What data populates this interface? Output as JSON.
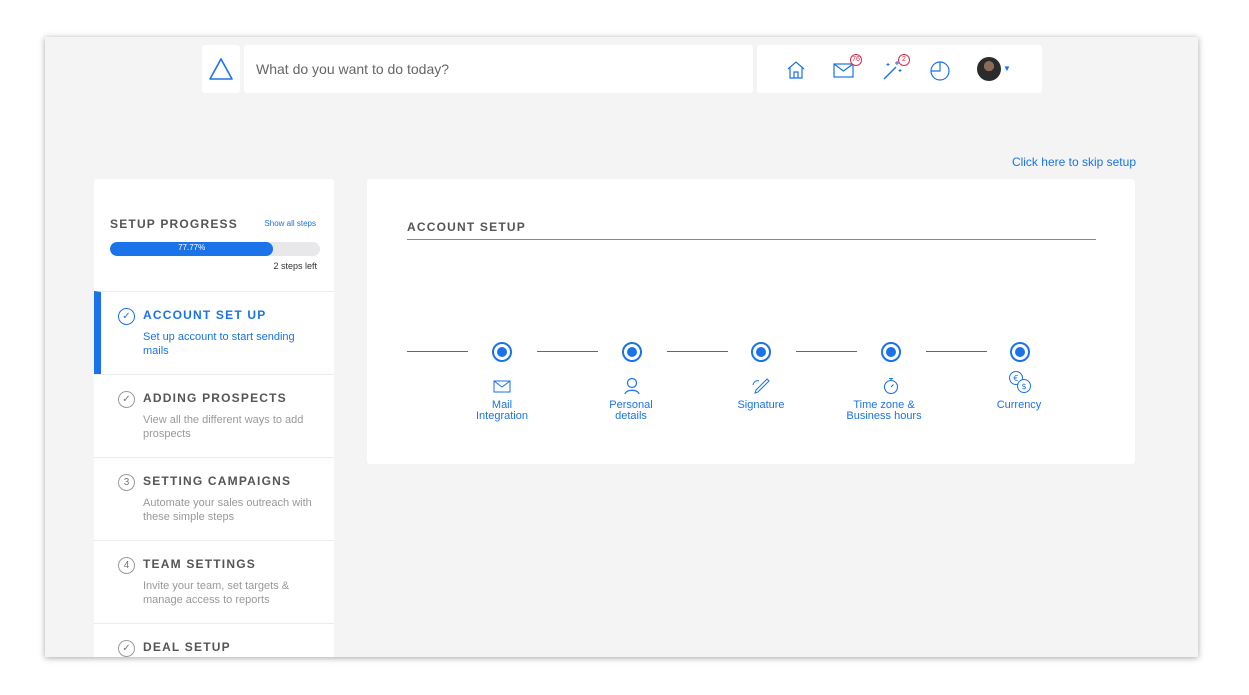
{
  "header": {
    "search_placeholder": "What do you want to do today?",
    "mail_badge": "76",
    "notifications_badge": "2"
  },
  "skip_link": "Click here to skip setup",
  "setup_progress": {
    "title": "SETUP PROGRESS",
    "show_all": "Show all steps",
    "percent_label": "77.77%",
    "percent_value": 0.7777,
    "steps_left": "2 steps left"
  },
  "steps": [
    {
      "badge": "✓",
      "title": "ACCOUNT SET UP",
      "desc": "Set up account to start sending mails",
      "state": "active"
    },
    {
      "badge": "✓",
      "title": "ADDING PROSPECTS",
      "desc": "View all the different ways to add prospects",
      "state": "done"
    },
    {
      "badge": "3",
      "title": "SETTING CAMPAIGNS",
      "desc": "Automate your sales outreach with these simple steps",
      "state": "pending"
    },
    {
      "badge": "4",
      "title": "TEAM SETTINGS",
      "desc": "Invite your team, set targets & manage access to reports",
      "state": "pending"
    },
    {
      "badge": "✓",
      "title": "DEAL SETUP",
      "desc": "",
      "state": "done"
    }
  ],
  "main": {
    "title": "ACCOUNT SETUP",
    "stepper": [
      {
        "icon": "envelope-icon",
        "label_line1": "Mail",
        "label_line2": "Integration"
      },
      {
        "icon": "user-icon",
        "label_line1": "Personal",
        "label_line2": "details"
      },
      {
        "icon": "pen-icon",
        "label_line1": "Signature",
        "label_line2": ""
      },
      {
        "icon": "stopwatch-icon",
        "label_line1": "Time zone &",
        "label_line2": "Business hours"
      },
      {
        "icon": "currency-icon",
        "label_line1": "Currency",
        "label_line2": ""
      }
    ]
  },
  "colors": {
    "accent": "#1a73e8",
    "badge": "#e0294b",
    "background": "#f4f4f5"
  }
}
